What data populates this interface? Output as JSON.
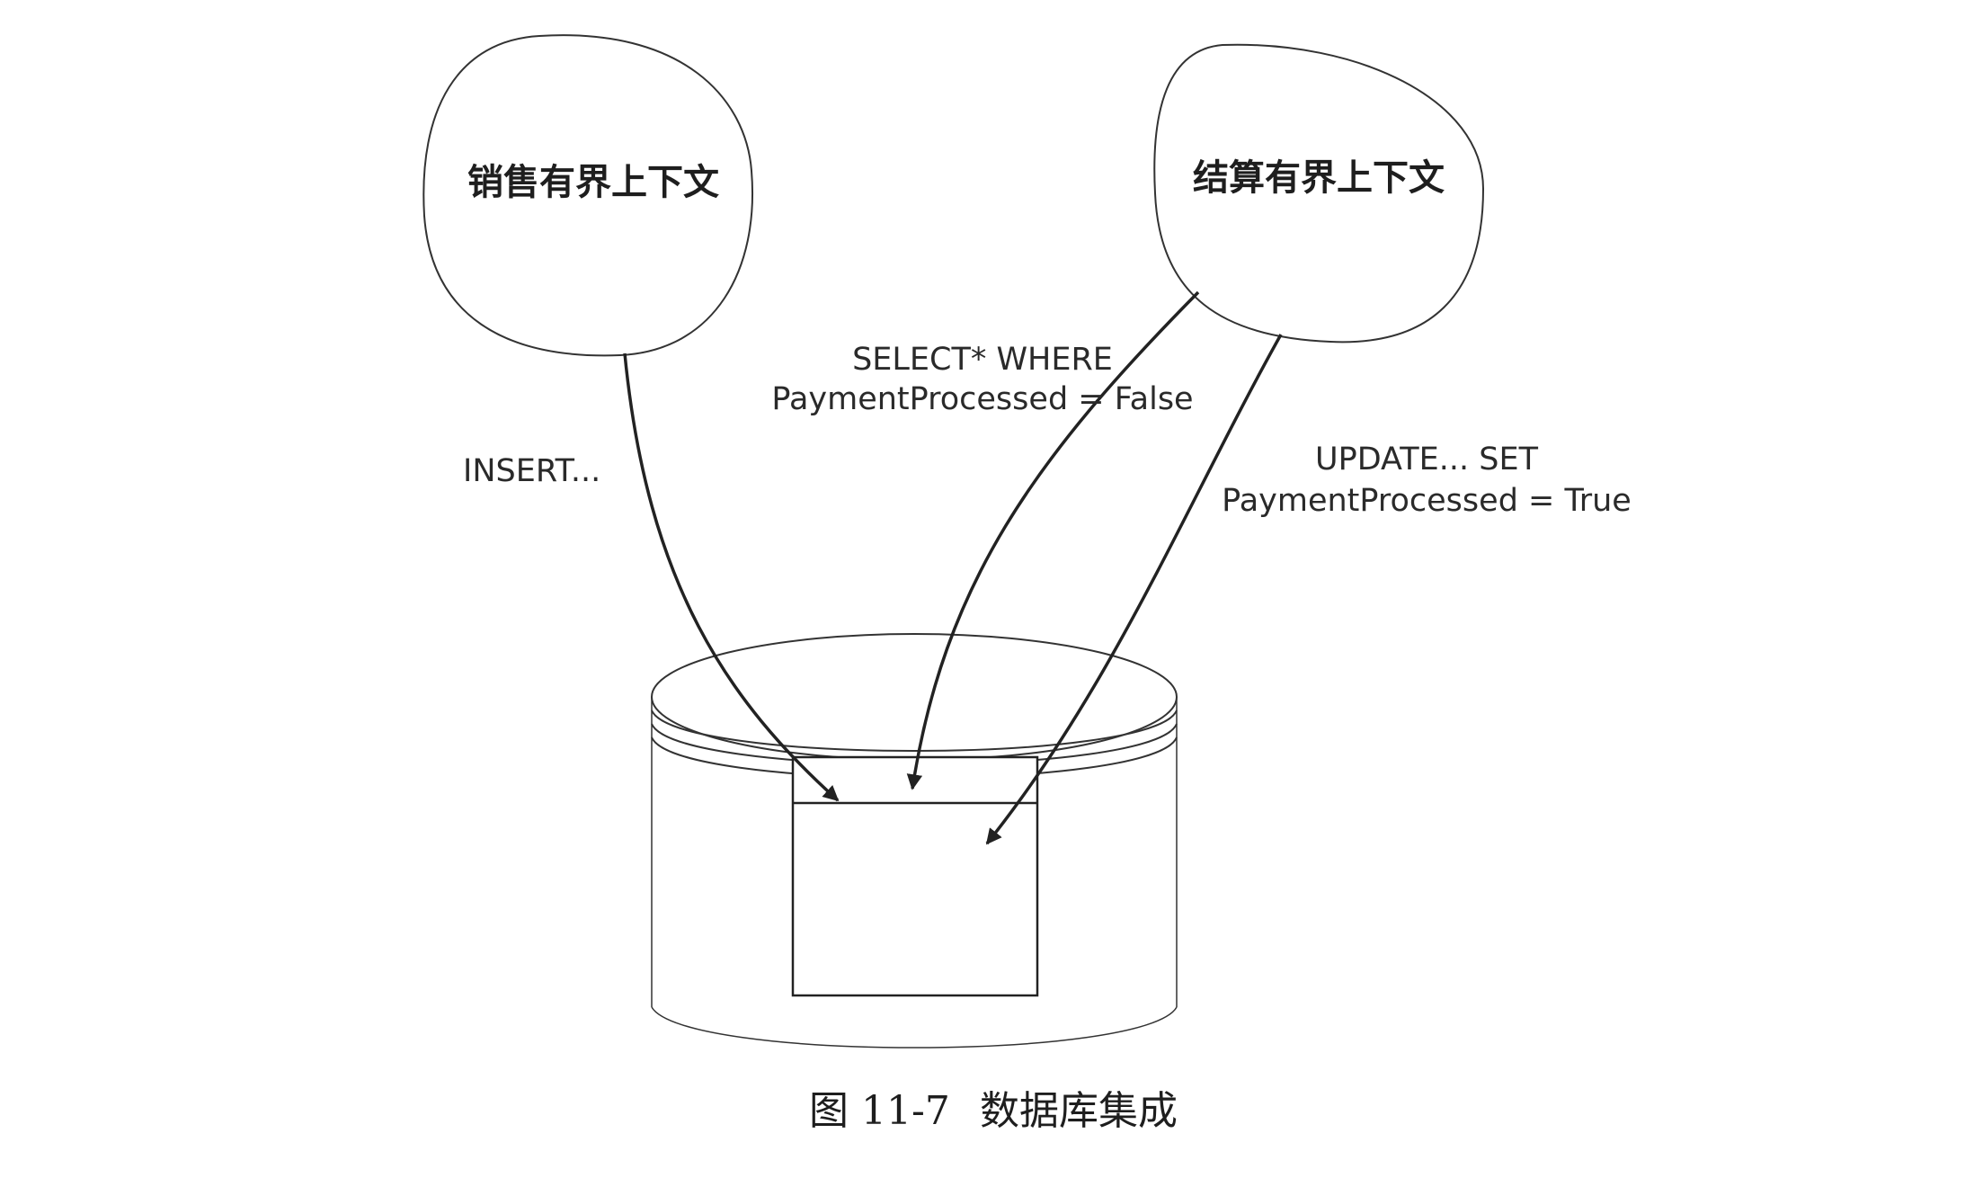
{
  "contexts": {
    "sales": {
      "label": "销售有界上下文"
    },
    "billing": {
      "label": "结算有界上下文"
    }
  },
  "operations": {
    "insert": {
      "label": "INSERT..."
    },
    "select": {
      "line1": "SELECT* WHERE",
      "line2": "PaymentProcessed = False"
    },
    "update": {
      "line1": "UPDATE... SET",
      "line2": "PaymentProcessed = True"
    }
  },
  "caption": {
    "number": "图 11-7",
    "text": "数据库集成"
  },
  "colors": {
    "line": "#333333",
    "arrow": "#222222",
    "background": "#ffffff"
  }
}
